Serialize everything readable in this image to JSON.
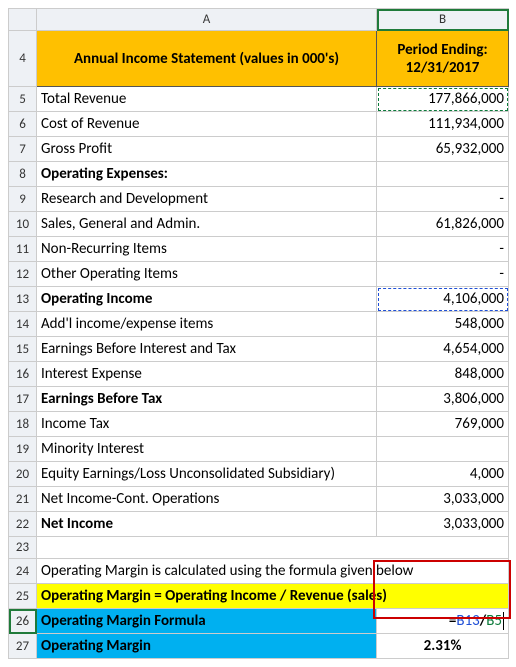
{
  "columns": {
    "A": "A",
    "B": "B"
  },
  "header": {
    "A": "Annual Income Statement (values in 000's)",
    "B": "Period Ending: 12/31/2017"
  },
  "rows": {
    "r5": {
      "num": "5",
      "A": "Total Revenue",
      "B": "177,866,000"
    },
    "r6": {
      "num": "6",
      "A": "Cost of Revenue",
      "B": "111,934,000"
    },
    "r7": {
      "num": "7",
      "A": "Gross Profit",
      "B": "65,932,000"
    },
    "r8": {
      "num": "8",
      "A": "Operating Expenses:",
      "B": ""
    },
    "r9": {
      "num": "9",
      "A": "Research and Development",
      "B": "-"
    },
    "r10": {
      "num": "10",
      "A": "Sales, General and Admin.",
      "B": "61,826,000"
    },
    "r11": {
      "num": "11",
      "A": "Non-Recurring Items",
      "B": "-"
    },
    "r12": {
      "num": "12",
      "A": "Other Operating Items",
      "B": "-"
    },
    "r13": {
      "num": "13",
      "A": "Operating Income",
      "B": "4,106,000"
    },
    "r14": {
      "num": "14",
      "A": "Add'l income/expense items",
      "B": "548,000"
    },
    "r15": {
      "num": "15",
      "A": "Earnings Before Interest and Tax",
      "B": "4,654,000"
    },
    "r16": {
      "num": "16",
      "A": "Interest Expense",
      "B": "848,000"
    },
    "r17": {
      "num": "17",
      "A": "Earnings Before Tax",
      "B": "3,806,000"
    },
    "r18": {
      "num": "18",
      "A": "Income Tax",
      "B": "769,000"
    },
    "r19": {
      "num": "19",
      "A": "Minority Interest",
      "B": ""
    },
    "r20": {
      "num": "20",
      "A": "Equity Earnings/Loss Unconsolidated Subsidiary)",
      "B": "4,000"
    },
    "r21": {
      "num": "21",
      "A": "Net Income-Cont. Operations",
      "B": "3,033,000"
    },
    "r22": {
      "num": "22",
      "A": "Net Income",
      "B": "3,033,000"
    },
    "r23": {
      "num": "23",
      "A": "",
      "B": ""
    },
    "r24": {
      "num": "24",
      "A": "Operating Margin is calculated using the formula given below",
      "B": ""
    },
    "r25": {
      "num": "25",
      "A": "Operating Margin = Operating Income / Revenue (sales)",
      "B": ""
    },
    "r26": {
      "num": "26",
      "A": "Operating Margin Formula",
      "B_eq": "=",
      "B_ref1": "B13",
      "B_slash": "/",
      "B_ref2": "B5"
    },
    "r27": {
      "num": "27",
      "A": "Operating Margin",
      "B": "2.31%"
    }
  },
  "header_rownum": "4",
  "chart_data": {
    "type": "table",
    "title": "Annual Income Statement (values in 000's)",
    "period": "12/31/2017",
    "unit": "000's",
    "rows": [
      {
        "label": "Total Revenue",
        "value": 177866000
      },
      {
        "label": "Cost of Revenue",
        "value": 111934000
      },
      {
        "label": "Gross Profit",
        "value": 65932000
      },
      {
        "label": "Operating Expenses:",
        "value": null
      },
      {
        "label": "Research and Development",
        "value": null
      },
      {
        "label": "Sales, General and Admin.",
        "value": 61826000
      },
      {
        "label": "Non-Recurring Items",
        "value": null
      },
      {
        "label": "Other Operating Items",
        "value": null
      },
      {
        "label": "Operating Income",
        "value": 4106000
      },
      {
        "label": "Add'l income/expense items",
        "value": 548000
      },
      {
        "label": "Earnings Before Interest and Tax",
        "value": 4654000
      },
      {
        "label": "Interest Expense",
        "value": 848000
      },
      {
        "label": "Earnings Before Tax",
        "value": 3806000
      },
      {
        "label": "Income Tax",
        "value": 769000
      },
      {
        "label": "Minority Interest",
        "value": null
      },
      {
        "label": "Equity Earnings/Loss Unconsolidated Subsidiary)",
        "value": 4000
      },
      {
        "label": "Net Income-Cont. Operations",
        "value": 3033000
      },
      {
        "label": "Net Income",
        "value": 3033000
      }
    ],
    "formula": "Operating Margin = Operating Income / Revenue (sales)",
    "operating_margin": 0.0231,
    "cell_formula": "=B13/B5"
  }
}
